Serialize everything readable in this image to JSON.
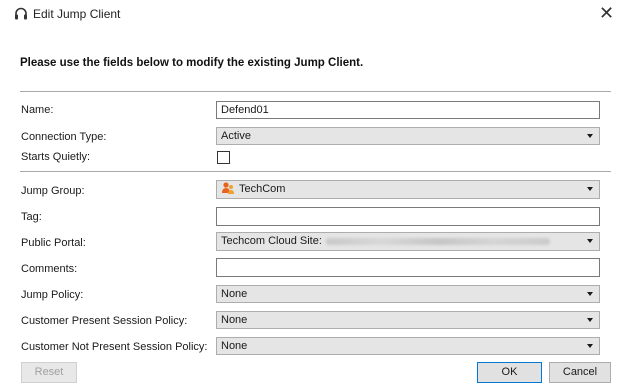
{
  "window": {
    "title": "Edit Jump Client"
  },
  "intro": "Please use the fields below to modify the existing Jump Client.",
  "fields": {
    "name": {
      "label": "Name:",
      "value": "Defend01"
    },
    "connection_type": {
      "label": "Connection Type:",
      "value": "Active"
    },
    "starts_quietly": {
      "label": "Starts Quietly:",
      "checked": false
    },
    "jump_group": {
      "label": "Jump Group:",
      "value": "TechCom",
      "icon": "group-icon"
    },
    "tag": {
      "label": "Tag:",
      "value": ""
    },
    "public_portal": {
      "label": "Public Portal:",
      "value": "Techcom Cloud Site:"
    },
    "comments": {
      "label": "Comments:",
      "value": ""
    },
    "jump_policy": {
      "label": "Jump Policy:",
      "value": "None"
    },
    "present_policy": {
      "label": "Customer Present Session Policy:",
      "value": "None"
    },
    "not_present_policy": {
      "label": "Customer Not Present Session Policy:",
      "value": "None"
    }
  },
  "buttons": {
    "reset": "Reset",
    "ok": "OK",
    "cancel": "Cancel"
  },
  "colors": {
    "dialog_bg": "#ffffff",
    "select_bg": "#e5e5e5",
    "button_bg": "#e1e1e1",
    "ok_border": "#0078d7",
    "group_icon": "#e8641b"
  }
}
